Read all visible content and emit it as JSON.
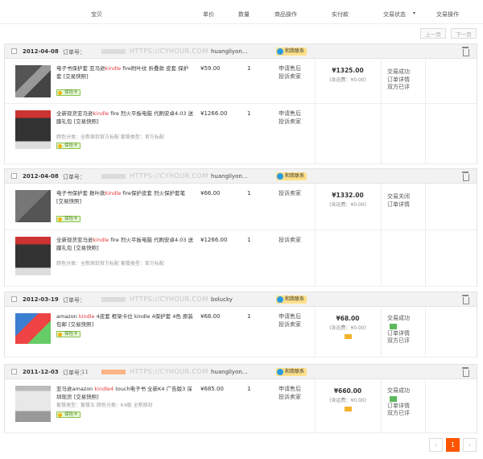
{
  "header": {
    "item": "宝贝",
    "unit_price": "单价",
    "quantity": "数量",
    "item_ops": "商品操作",
    "paid": "实付款",
    "trade_status": "交易状态",
    "trade_ops": "交易操作"
  },
  "pager": {
    "prev": "上一页",
    "next": "下一页",
    "current_page": "1",
    "prev_arrow": "‹",
    "next_arrow": "›"
  },
  "common": {
    "order_no_label": "订单号：",
    "watermark": "HTTPS://CYHOUR.COM",
    "contact": "和我联系",
    "insurance": "保险卡",
    "shipping_paren": "(含运费：¥0.00)",
    "complain": "投诉卖家",
    "refund": "申请售后"
  },
  "orders": [
    {
      "date": "2012-04-08",
      "order_no": "",
      "seller": "huangliyon...",
      "paid": "¥1325.00",
      "status": [
        "交易成功",
        "订单详情",
        "双方已评"
      ],
      "items": [
        {
          "title_pre": "电子书保护套 亚马逊",
          "title_hl": "kindle",
          "title_post": " fire附叶纹 折叠款 皮套 保护套 [交易快照]",
          "props": "",
          "price": "¥59.00",
          "qty": "1",
          "ops": [
            "申请售后",
            "投诉卖家"
          ]
        },
        {
          "title_pre": "全新现货亚马逊",
          "title_hl": "kindle",
          "title_post": " fire 烈火平板电脑 代刷安卓4.03 送膜礼包 [交易快照]",
          "props": "颜色分类：全新原封官方标配  套餐类型：官方标配",
          "price": "¥1266.00",
          "qty": "1",
          "ops": [
            "申请售后",
            "投诉卖家"
          ]
        }
      ]
    },
    {
      "date": "2012-04-08",
      "order_no": "",
      "seller": "huangliyon...",
      "paid": "¥1332.00",
      "status": [
        "交易关闭",
        "订单详情"
      ],
      "items": [
        {
          "title_pre": "电子书保护套 数叶款",
          "title_hl": "kindle",
          "title_post": " fire保护皮套 烈火保护套笔 [交易快照]",
          "props": "",
          "price": "¥66.00",
          "qty": "1",
          "ops": [
            "投诉卖家"
          ]
        },
        {
          "title_pre": "全新现货亚马逊",
          "title_hl": "kindle",
          "title_post": " fire 烈火平板电脑 代刷安卓4.03 送膜礼包 [交易快照]",
          "props": "颜色分类：全新原封官方标配  套餐类型：官方标配",
          "price": "¥1266.00",
          "qty": "1",
          "ops": [
            "投诉卖家"
          ]
        }
      ]
    },
    {
      "date": "2012-03-19",
      "order_no": "",
      "seller": "bolucky",
      "paid": "¥68.00",
      "status": [
        "交易成功",
        "订单详情",
        "双方已评"
      ],
      "items": [
        {
          "title_pre": "amazon ",
          "title_hl": "kindle",
          "title_post": " 4皮套 框架卡位 kindle 4保护套 4色 原装包邮 [交易快照]",
          "props": "",
          "price": "¥68.00",
          "qty": "1",
          "ops": [
            "申请售后",
            "投诉卖家"
          ]
        }
      ]
    },
    {
      "date": "2011-12-03",
      "order_no": "11",
      "seller": "huangliyon...",
      "paid": "¥660.00",
      "status": [
        "交易成功",
        "订单详情",
        "双方已评"
      ],
      "items": [
        {
          "title_pre": "亚马逊amazon ",
          "title_hl": "kindle4",
          "title_post": " touch电子书 全新K4 广告版3 深圳现货 [交易快照]",
          "props": "套餐类型：套餐五  颜色分类：K4版 全新原封",
          "price": "¥685.00",
          "qty": "1",
          "ops": [
            "申请售后",
            "投诉卖家"
          ]
        }
      ]
    }
  ]
}
